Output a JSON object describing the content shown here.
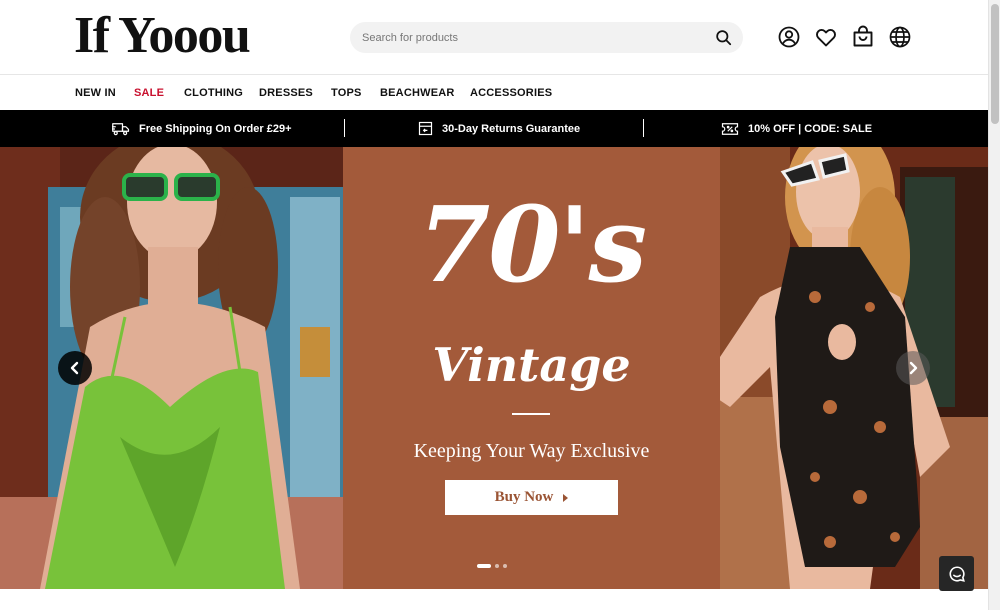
{
  "brand": {
    "logo_text": "If Yooou"
  },
  "search": {
    "placeholder": "Search for products",
    "value": "",
    "icon": "search-icon"
  },
  "header_icons": [
    "account-icon",
    "wishlist-heart-icon",
    "shopping-bag-icon",
    "globe-icon"
  ],
  "nav": {
    "items": [
      {
        "label": "NEW IN"
      },
      {
        "label": "SALE",
        "highlight": true
      },
      {
        "label": "CLOTHING"
      },
      {
        "label": "DRESSES"
      },
      {
        "label": "TOPS"
      },
      {
        "label": "BEACHWEAR"
      },
      {
        "label": "ACCESSORIES"
      }
    ]
  },
  "promo_bar": {
    "items": [
      {
        "icon": "delivery-truck-icon",
        "text": "Free Shipping On Order £29+"
      },
      {
        "icon": "return-box-icon",
        "text": "30-Day Returns Guarantee"
      },
      {
        "icon": "discount-ticket-icon",
        "text": "10% OFF | CODE: SALE"
      }
    ]
  },
  "hero": {
    "headline": "70's",
    "subheadline": "Vintage",
    "tagline": "Keeping Your Way Exclusive",
    "cta_label": "Buy Now",
    "slide_count": 3,
    "active_slide": 1
  },
  "colors": {
    "sale": "#c8102e",
    "promo_bg": "#000000",
    "hero_panel": "#a35a3a",
    "cta_text": "#9a5434",
    "search_bg": "#f2f2f2"
  },
  "chat": {
    "icon": "chat-bubble-icon"
  }
}
